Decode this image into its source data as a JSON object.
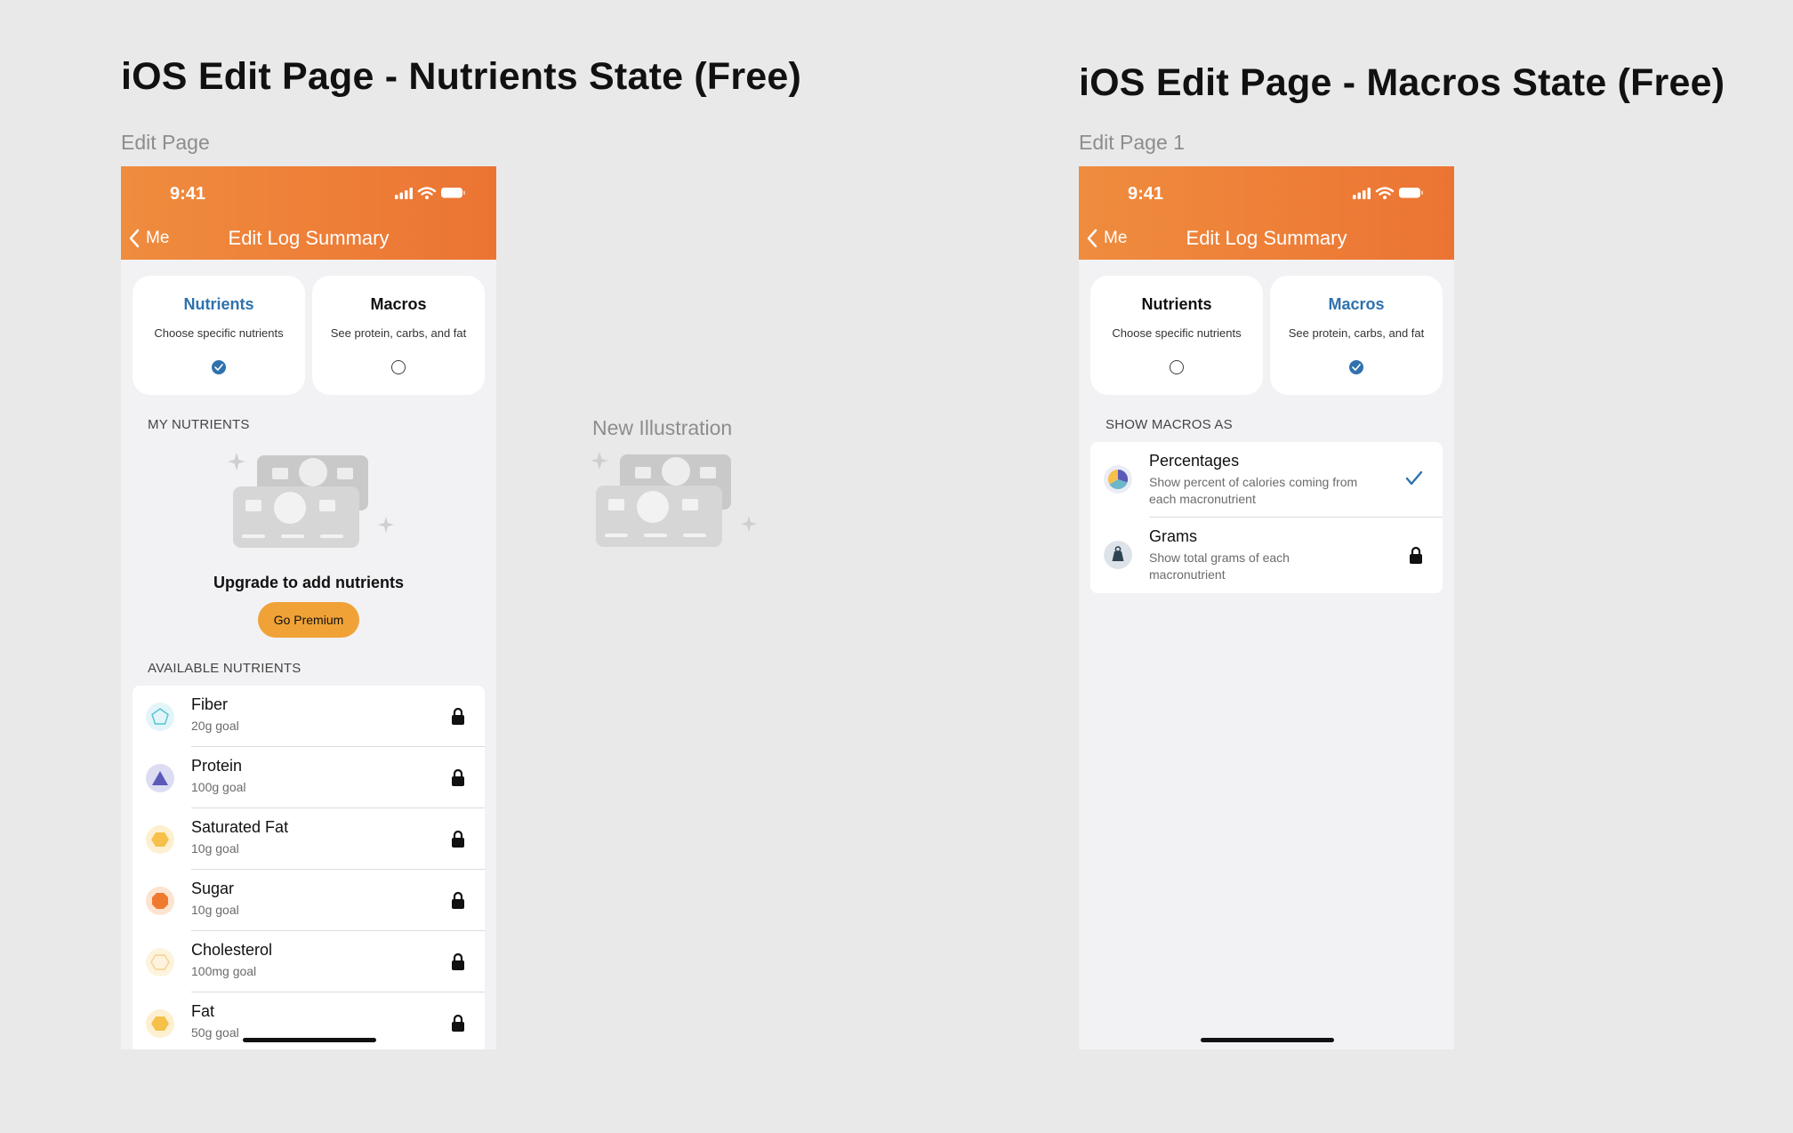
{
  "canvas": {
    "left_frame_title": "iOS Edit Page - Nutrients State (Free)",
    "right_frame_title": "iOS Edit Page - Macros State (Free)",
    "left_frame_label": "Edit Page",
    "right_frame_label": "Edit Page 1",
    "illustration_label": "New Illustration"
  },
  "status_bar": {
    "time": "9:41"
  },
  "nav": {
    "back_label": "Me",
    "title": "Edit Log Summary"
  },
  "mode_cards": {
    "nutrients": {
      "title": "Nutrients",
      "subtitle": "Choose specific nutrients"
    },
    "macros": {
      "title": "Macros",
      "subtitle": "See protein, carbs, and fat"
    }
  },
  "nutrients_screen": {
    "selected_mode": "nutrients",
    "my_nutrients_label": "MY NUTRIENTS",
    "upgrade_title": "Upgrade to add nutrients",
    "premium_button": "Go Premium",
    "available_label": "AVAILABLE NUTRIENTS",
    "nutrients": [
      {
        "name": "Fiber",
        "goal": "20g goal",
        "icon": "pentagon-icon"
      },
      {
        "name": "Protein",
        "goal": "100g goal",
        "icon": "triangle-icon"
      },
      {
        "name": "Saturated Fat",
        "goal": "10g goal",
        "icon": "hexagon-icon"
      },
      {
        "name": "Sugar",
        "goal": "10g goal",
        "icon": "octagon-icon"
      },
      {
        "name": "Cholesterol",
        "goal": "100mg goal",
        "icon": "hexagon-outline-icon"
      },
      {
        "name": "Fat",
        "goal": "50g goal",
        "icon": "hexagon-icon"
      }
    ]
  },
  "macros_screen": {
    "selected_mode": "macros",
    "section_label": "SHOW MACROS AS",
    "options": [
      {
        "name": "Percentages",
        "description": "Show percent of calories coming from each macronutrient",
        "icon": "pie-chart-icon",
        "state": "selected"
      },
      {
        "name": "Grams",
        "description": "Show total grams of each macronutrient",
        "icon": "weight-icon",
        "state": "locked"
      }
    ]
  },
  "colors": {
    "header_start": "#ef8c3e",
    "header_end": "#ec7433",
    "accent_blue": "#2f72ad",
    "premium_orange": "#f0a237",
    "illustration_gray": "#c9c9c9"
  }
}
